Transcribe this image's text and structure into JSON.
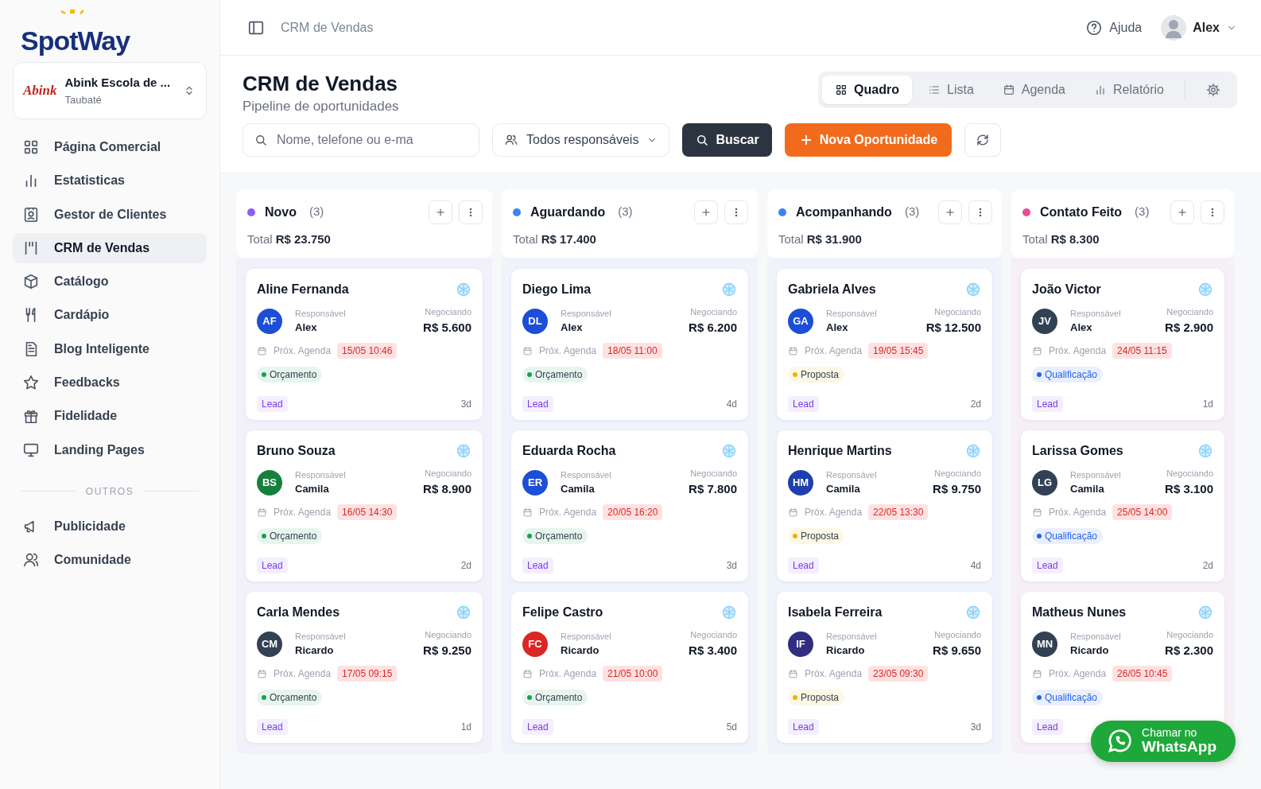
{
  "brand": {
    "name": "SpotWay"
  },
  "org": {
    "logo_text": "Abink",
    "name": "Abink Escola de ...",
    "city": "Taubaté"
  },
  "sidebar": {
    "items": [
      {
        "label": "Página Comercial",
        "selected": false
      },
      {
        "label": "Estatisticas",
        "selected": false
      },
      {
        "label": "Gestor de Clientes",
        "selected": false
      },
      {
        "label": "CRM de Vendas",
        "selected": true
      },
      {
        "label": "Catálogo",
        "selected": false
      },
      {
        "label": "Cardápio",
        "selected": false
      },
      {
        "label": "Blog Inteligente",
        "selected": false
      },
      {
        "label": "Feedbacks",
        "selected": false
      },
      {
        "label": "Fidelidade",
        "selected": false
      },
      {
        "label": "Landing Pages",
        "selected": false
      }
    ],
    "section": "OUTROS",
    "other_items": [
      {
        "label": "Publicidade",
        "selected": false
      },
      {
        "label": "Comunidade",
        "selected": false
      }
    ]
  },
  "topbar": {
    "breadcrumb": "CRM de Vendas",
    "help": "Ajuda",
    "user": "Alex"
  },
  "page": {
    "title": "CRM de Vendas",
    "subtitle": "Pipeline de oportunidades"
  },
  "views": [
    {
      "label": "Quadro",
      "selected": true
    },
    {
      "label": "Lista",
      "selected": false
    },
    {
      "label": "Agenda",
      "selected": false
    },
    {
      "label": "Relatório",
      "selected": false
    }
  ],
  "filters": {
    "search_placeholder": "Nome, telefone ou e-ma",
    "owner": "Todos responsáveis",
    "search_button": "Buscar",
    "new_button": "Nova Oportunidade"
  },
  "columns": [
    {
      "name": "Novo",
      "count": "(3)",
      "color": "#8b5cf6",
      "total_label": "Total",
      "total": "R$ 23.750",
      "cards": [
        {
          "name": "Aline Fernanda",
          "initials": "AF",
          "color": "#1d4ed8",
          "owner_label": "Responsável",
          "owner": "Alex",
          "value_label": "Negociando",
          "value": "R$ 5.600",
          "agenda_label": "Próx. Agenda",
          "agenda": "15/05 10:46",
          "tag": {
            "label": "Orçamento",
            "color": "#16a34a"
          },
          "source": "Lead",
          "age": "3d"
        },
        {
          "name": "Bruno Souza",
          "initials": "BS",
          "color": "#15803d",
          "owner_label": "Responsável",
          "owner": "Camila",
          "value_label": "Negociando",
          "value": "R$ 8.900",
          "agenda_label": "Próx. Agenda",
          "agenda": "16/05 14:30",
          "tag": {
            "label": "Orçamento",
            "color": "#16a34a"
          },
          "source": "Lead",
          "age": "2d"
        },
        {
          "name": "Carla Mendes",
          "initials": "CM",
          "color": "#334155",
          "owner_label": "Responsável",
          "owner": "Ricardo",
          "value_label": "Negociando",
          "value": "R$ 9.250",
          "agenda_label": "Próx. Agenda",
          "agenda": "17/05 09:15",
          "tag": {
            "label": "Orçamento",
            "color": "#16a34a"
          },
          "source": "Lead",
          "age": "1d"
        }
      ]
    },
    {
      "name": "Aguardando",
      "count": "(3)",
      "color": "#3b82f6",
      "total_label": "Total",
      "total": "R$ 17.400",
      "cards": [
        {
          "name": "Diego Lima",
          "initials": "DL",
          "color": "#1d4ed8",
          "owner_label": "Responsável",
          "owner": "Alex",
          "value_label": "Negociando",
          "value": "R$ 6.200",
          "agenda_label": "Próx. Agenda",
          "agenda": "18/05 11:00",
          "tag": {
            "label": "Orçamento",
            "color": "#16a34a"
          },
          "source": "Lead",
          "age": "4d"
        },
        {
          "name": "Eduarda Rocha",
          "initials": "ER",
          "color": "#1d4ed8",
          "owner_label": "Responsável",
          "owner": "Camila",
          "value_label": "Negociando",
          "value": "R$ 7.800",
          "agenda_label": "Próx. Agenda",
          "agenda": "20/05 16:20",
          "tag": {
            "label": "Orçamento",
            "color": "#16a34a"
          },
          "source": "Lead",
          "age": "3d"
        },
        {
          "name": "Felipe Castro",
          "initials": "FC",
          "color": "#dc2626",
          "owner_label": "Responsável",
          "owner": "Ricardo",
          "value_label": "Negociando",
          "value": "R$ 3.400",
          "agenda_label": "Próx. Agenda",
          "agenda": "21/05 10:00",
          "tag": {
            "label": "Orçamento",
            "color": "#16a34a"
          },
          "source": "Lead",
          "age": "5d"
        }
      ]
    },
    {
      "name": "Acompanhando",
      "count": "(3)",
      "color": "#3b82f6",
      "total_label": "Total",
      "total": "R$ 31.900",
      "cards": [
        {
          "name": "Gabriela Alves",
          "initials": "GA",
          "color": "#1d4ed8",
          "owner_label": "Responsável",
          "owner": "Alex",
          "value_label": "Negociando",
          "value": "R$ 12.500",
          "agenda_label": "Próx. Agenda",
          "agenda": "19/05 15:45",
          "tag": {
            "label": "Proposta",
            "color": "#eab308"
          },
          "source": "Lead",
          "age": "2d"
        },
        {
          "name": "Henrique Martins",
          "initials": "HM",
          "color": "#1e40af",
          "owner_label": "Responsável",
          "owner": "Camila",
          "value_label": "Negociando",
          "value": "R$ 9.750",
          "agenda_label": "Próx. Agenda",
          "agenda": "22/05 13:30",
          "tag": {
            "label": "Proposta",
            "color": "#eab308"
          },
          "source": "Lead",
          "age": "4d"
        },
        {
          "name": "Isabela Ferreira",
          "initials": "IF",
          "color": "#312e81",
          "owner_label": "Responsável",
          "owner": "Ricardo",
          "value_label": "Negociando",
          "value": "R$ 9.650",
          "agenda_label": "Próx. Agenda",
          "agenda": "23/05 09:30",
          "tag": {
            "label": "Proposta",
            "color": "#eab308"
          },
          "source": "Lead",
          "age": "3d"
        }
      ]
    },
    {
      "name": "Contato Feito",
      "count": "(3)",
      "color": "#ec4899",
      "total_label": "Total",
      "total": "R$ 8.300",
      "cards": [
        {
          "name": "João Victor",
          "initials": "JV",
          "color": "#334155",
          "owner_label": "Responsável",
          "owner": "Alex",
          "value_label": "Negociando",
          "value": "R$ 2.900",
          "agenda_label": "Próx. Agenda",
          "agenda": "24/05 11:15",
          "tag": {
            "label": "Qualificação",
            "color": "#2563eb"
          },
          "source": "Lead",
          "age": "1d"
        },
        {
          "name": "Larissa Gomes",
          "initials": "LG",
          "color": "#334155",
          "owner_label": "Responsável",
          "owner": "Camila",
          "value_label": "Negociando",
          "value": "R$ 3.100",
          "agenda_label": "Próx. Agenda",
          "agenda": "25/05 14:00",
          "tag": {
            "label": "Qualificação",
            "color": "#2563eb"
          },
          "source": "Lead",
          "age": "2d"
        },
        {
          "name": "Matheus Nunes",
          "initials": "MN",
          "color": "#334155",
          "owner_label": "Responsável",
          "owner": "Ricardo",
          "value_label": "Negociando",
          "value": "R$ 2.300",
          "agenda_label": "Próx. Agenda",
          "agenda": "26/05 10:45",
          "tag": {
            "label": "Qualificação",
            "color": "#2563eb"
          },
          "source": "Lead"
        }
      ]
    }
  ],
  "whatsapp": {
    "line1": "Chamar no",
    "line2": "WhatsApp"
  }
}
